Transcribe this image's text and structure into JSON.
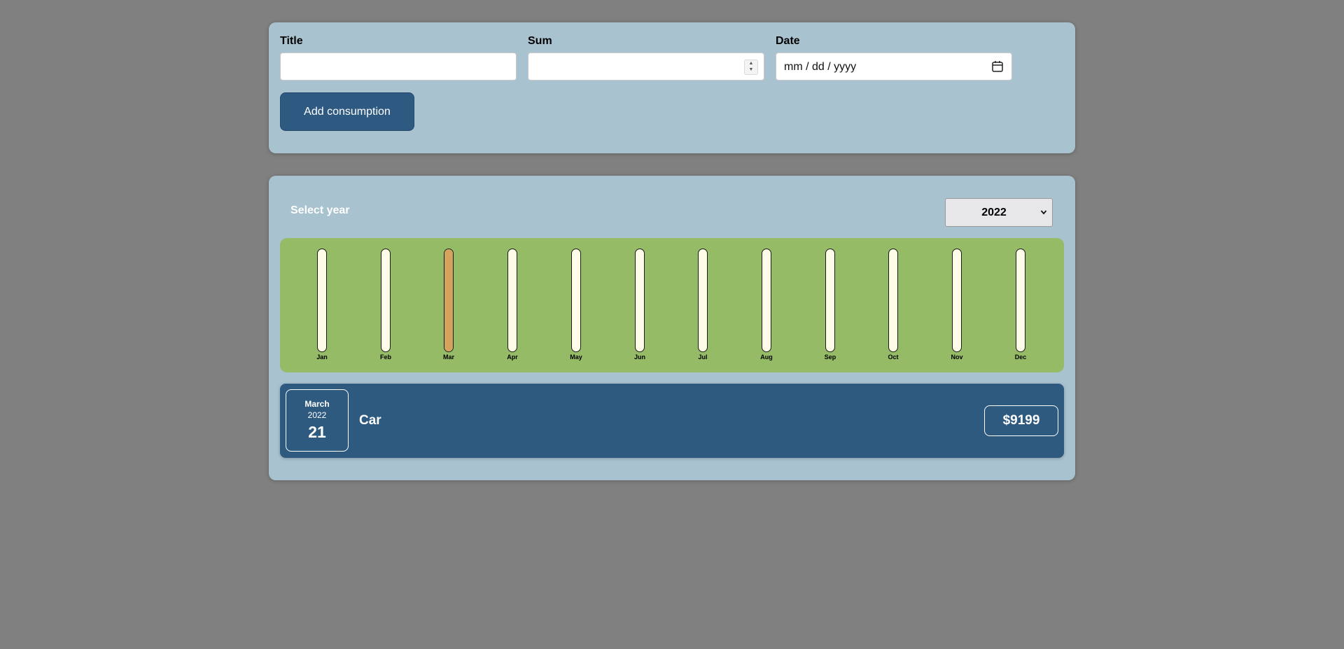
{
  "form": {
    "title_label": "Title",
    "title_value": "",
    "sum_label": "Sum",
    "sum_value": "",
    "date_label": "Date",
    "date_placeholder": "mm / dd / yyyy",
    "add_button": "Add consumption"
  },
  "filter": {
    "label": "Select year",
    "selected_year": "2022",
    "chevron_icon": "chevron-down-icon"
  },
  "colors": {
    "panel": "#a9c2d0",
    "chart_bg": "#95bb66",
    "bar_empty": "#fefbe6",
    "bar_fill": "#d4a35c",
    "accent": "#2e5a82"
  },
  "chart_data": {
    "type": "bar",
    "categories": [
      "Jan",
      "Feb",
      "Mar",
      "Apr",
      "May",
      "Jun",
      "Jul",
      "Aug",
      "Sep",
      "Oct",
      "Nov",
      "Dec"
    ],
    "values": [
      0,
      0,
      9199,
      0,
      0,
      0,
      0,
      0,
      0,
      0,
      0,
      0
    ],
    "title": "",
    "xlabel": "",
    "ylabel": ""
  },
  "expenses": [
    {
      "month": "March",
      "year": "2022",
      "day": "21",
      "title": "Car",
      "amount": "$9199"
    }
  ]
}
